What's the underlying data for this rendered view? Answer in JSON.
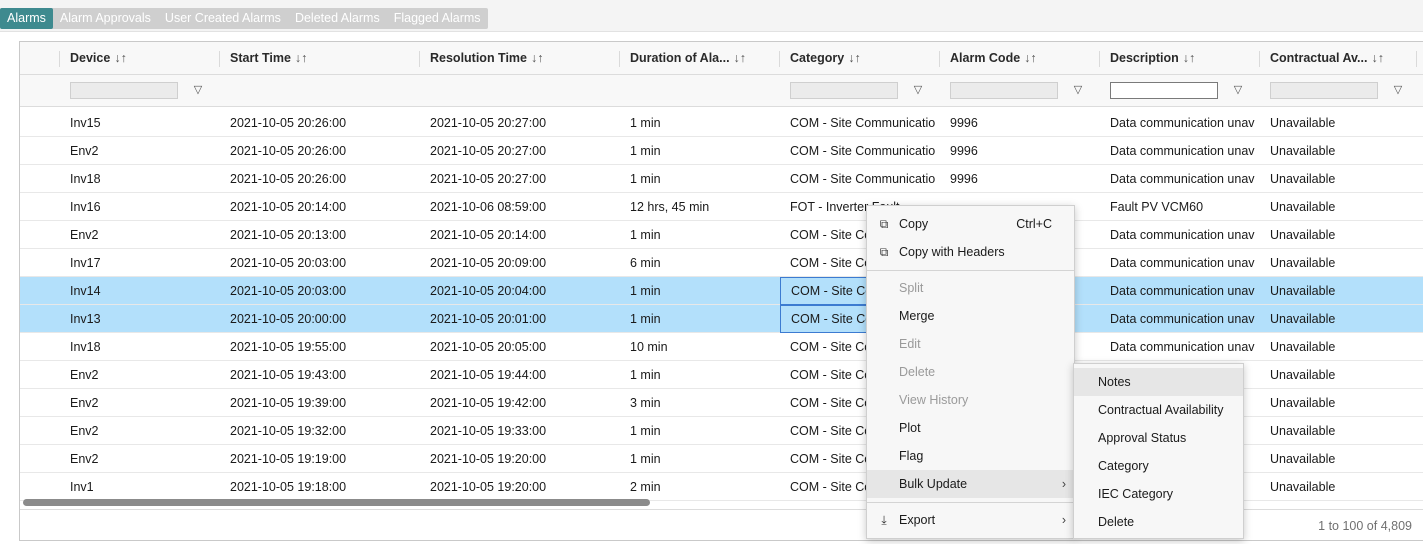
{
  "tabs": [
    {
      "label": "Alarms",
      "active": true
    },
    {
      "label": "Alarm Approvals",
      "active": false
    },
    {
      "label": "User Created Alarms",
      "active": false
    },
    {
      "label": "Deleted Alarms",
      "active": false
    },
    {
      "label": "Flagged Alarms",
      "active": false
    }
  ],
  "columns": [
    {
      "label": "Device",
      "sort": "↓↑",
      "filter": "grey"
    },
    {
      "label": "Start Time",
      "sort": "↓↑",
      "filter": "none"
    },
    {
      "label": "Resolution Time",
      "sort": "↓↑",
      "filter": "none"
    },
    {
      "label": "Duration of Ala...",
      "sort": "↓↑",
      "filter": "none"
    },
    {
      "label": "Category",
      "sort": "↓↑",
      "filter": "grey"
    },
    {
      "label": "Alarm Code",
      "sort": "↓↑",
      "filter": "grey"
    },
    {
      "label": "Description",
      "sort": "↓↑",
      "filter": "white"
    },
    {
      "label": "Contractual Av...",
      "sort": "↓↑",
      "filter": "grey"
    }
  ],
  "rows": [
    {
      "cells": [
        "Inv15",
        "2021-10-05 20:26:00",
        "2021-10-05 20:27:00",
        "1 min",
        "COM - Site Communicatio",
        "9996",
        "Data communication unav",
        "Unavailable"
      ],
      "selected": false
    },
    {
      "cells": [
        "Env2",
        "2021-10-05 20:26:00",
        "2021-10-05 20:27:00",
        "1 min",
        "COM - Site Communicatio",
        "9996",
        "Data communication unav",
        "Unavailable"
      ],
      "selected": false
    },
    {
      "cells": [
        "Inv18",
        "2021-10-05 20:26:00",
        "2021-10-05 20:27:00",
        "1 min",
        "COM - Site Communicatio",
        "9996",
        "Data communication unav",
        "Unavailable"
      ],
      "selected": false
    },
    {
      "cells": [
        "Inv16",
        "2021-10-05 20:14:00",
        "2021-10-06 08:59:00",
        "12 hrs, 45 min",
        "FOT - Inverter Fault",
        "",
        "Fault PV VCM60",
        "Unavailable"
      ],
      "selected": false
    },
    {
      "cells": [
        "Env2",
        "2021-10-05 20:13:00",
        "2021-10-05 20:14:00",
        "1 min",
        "COM - Site Co",
        "",
        "Data communication unav",
        "Unavailable"
      ],
      "selected": false
    },
    {
      "cells": [
        "Inv17",
        "2021-10-05 20:03:00",
        "2021-10-05 20:09:00",
        "6 min",
        "COM - Site Co",
        "",
        "Data communication unav",
        "Unavailable"
      ],
      "selected": false
    },
    {
      "cells": [
        "Inv14",
        "2021-10-05 20:03:00",
        "2021-10-05 20:04:00",
        "1 min",
        "COM - Site Co",
        "",
        "Data communication unav",
        "Unavailable"
      ],
      "selected": true
    },
    {
      "cells": [
        "Inv13",
        "2021-10-05 20:00:00",
        "2021-10-05 20:01:00",
        "1 min",
        "COM - Site Co",
        "",
        "Data communication unav",
        "Unavailable"
      ],
      "selected": true
    },
    {
      "cells": [
        "Inv18",
        "2021-10-05 19:55:00",
        "2021-10-05 20:05:00",
        "10 min",
        "COM - Site Co",
        "",
        "Data communication unav",
        "Unavailable"
      ],
      "selected": false
    },
    {
      "cells": [
        "Env2",
        "2021-10-05 19:43:00",
        "2021-10-05 19:44:00",
        "1 min",
        "COM - Site Co",
        "",
        "av",
        "Unavailable"
      ],
      "selected": false
    },
    {
      "cells": [
        "Env2",
        "2021-10-05 19:39:00",
        "2021-10-05 19:42:00",
        "3 min",
        "COM - Site Co",
        "",
        "av",
        "Unavailable"
      ],
      "selected": false
    },
    {
      "cells": [
        "Env2",
        "2021-10-05 19:32:00",
        "2021-10-05 19:33:00",
        "1 min",
        "COM - Site Co",
        "",
        "av",
        "Unavailable"
      ],
      "selected": false
    },
    {
      "cells": [
        "Env2",
        "2021-10-05 19:19:00",
        "2021-10-05 19:20:00",
        "1 min",
        "COM - Site Co",
        "",
        "av",
        "Unavailable"
      ],
      "selected": false
    },
    {
      "cells": [
        "Inv1",
        "2021-10-05 19:18:00",
        "2021-10-05 19:20:00",
        "2 min",
        "COM - Site Co",
        "",
        "av",
        "Unavailable"
      ],
      "selected": false
    }
  ],
  "footer": {
    "paging": "1 to 100 of 4,809"
  },
  "context_menu": {
    "items": [
      {
        "label": "Copy",
        "icon": "copy-icon",
        "glyph": "⧉",
        "shortcut": "Ctrl+C",
        "disabled": false
      },
      {
        "label": "Copy with Headers",
        "icon": "copy-icon",
        "glyph": "⧉",
        "disabled": false
      },
      {
        "separator": true
      },
      {
        "label": "Split",
        "disabled": true
      },
      {
        "label": "Merge",
        "disabled": false
      },
      {
        "label": "Edit",
        "disabled": true
      },
      {
        "label": "Delete",
        "disabled": true
      },
      {
        "label": "View History",
        "disabled": true
      },
      {
        "label": "Plot",
        "disabled": false
      },
      {
        "label": "Flag",
        "disabled": false
      },
      {
        "label": "Bulk Update",
        "disabled": false,
        "submenu": true,
        "highlighted": true
      },
      {
        "separator": true
      },
      {
        "label": "Export",
        "icon": "download-icon",
        "glyph": "⤓",
        "disabled": false,
        "submenu": true
      }
    ]
  },
  "submenu": {
    "items": [
      {
        "label": "Notes",
        "highlighted": true
      },
      {
        "label": "Contractual Availability"
      },
      {
        "label": "Approval Status"
      },
      {
        "label": "Category"
      },
      {
        "label": "IEC Category"
      },
      {
        "label": "Delete"
      }
    ]
  },
  "icons": {
    "filter": "▽",
    "submenu_arrow": "›"
  },
  "colors": {
    "active_tab": "#3e8a8f",
    "selected_row": "#b3e0fb",
    "focus_border": "#3c7bd1"
  }
}
